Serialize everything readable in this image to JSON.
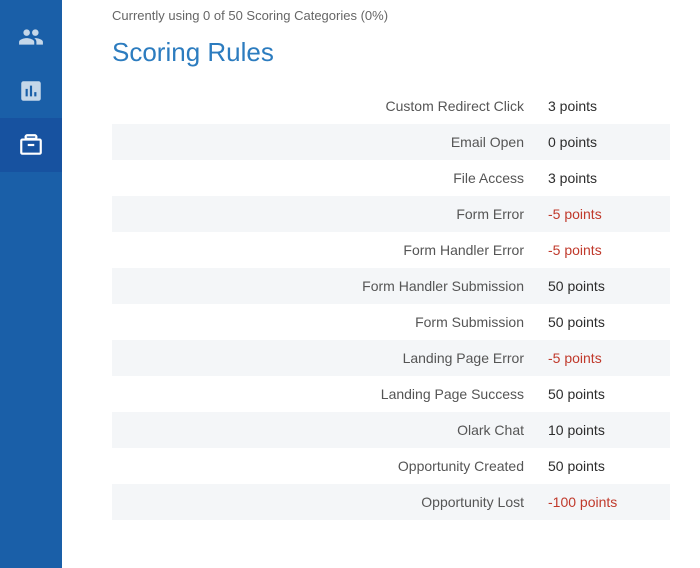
{
  "sidebar": {
    "items": [
      {
        "name": "people-icon",
        "label": "People",
        "active": false
      },
      {
        "name": "chart-icon",
        "label": "Reports",
        "active": false
      },
      {
        "name": "briefcase-icon",
        "label": "Scoring",
        "active": true
      }
    ]
  },
  "header": {
    "top_text": "Currently using 0 of 50 Scoring Categories (0%)",
    "title": "Scoring Rules"
  },
  "scoring_rules": [
    {
      "label": "Custom Redirect Click",
      "value": "3 points",
      "negative": false
    },
    {
      "label": "Email Open",
      "value": "0 points",
      "negative": false
    },
    {
      "label": "File Access",
      "value": "3 points",
      "negative": false
    },
    {
      "label": "Form Error",
      "value": "-5 points",
      "negative": true
    },
    {
      "label": "Form Handler Error",
      "value": "-5 points",
      "negative": true
    },
    {
      "label": "Form Handler Submission",
      "value": "50 points",
      "negative": false
    },
    {
      "label": "Form Submission",
      "value": "50 points",
      "negative": false
    },
    {
      "label": "Landing Page Error",
      "value": "-5 points",
      "negative": true
    },
    {
      "label": "Landing Page Success",
      "value": "50 points",
      "negative": false
    },
    {
      "label": "Olark Chat",
      "value": "10 points",
      "negative": false
    },
    {
      "label": "Opportunity Created",
      "value": "50 points",
      "negative": false
    },
    {
      "label": "Opportunity Lost",
      "value": "-100 points",
      "negative": true
    }
  ]
}
